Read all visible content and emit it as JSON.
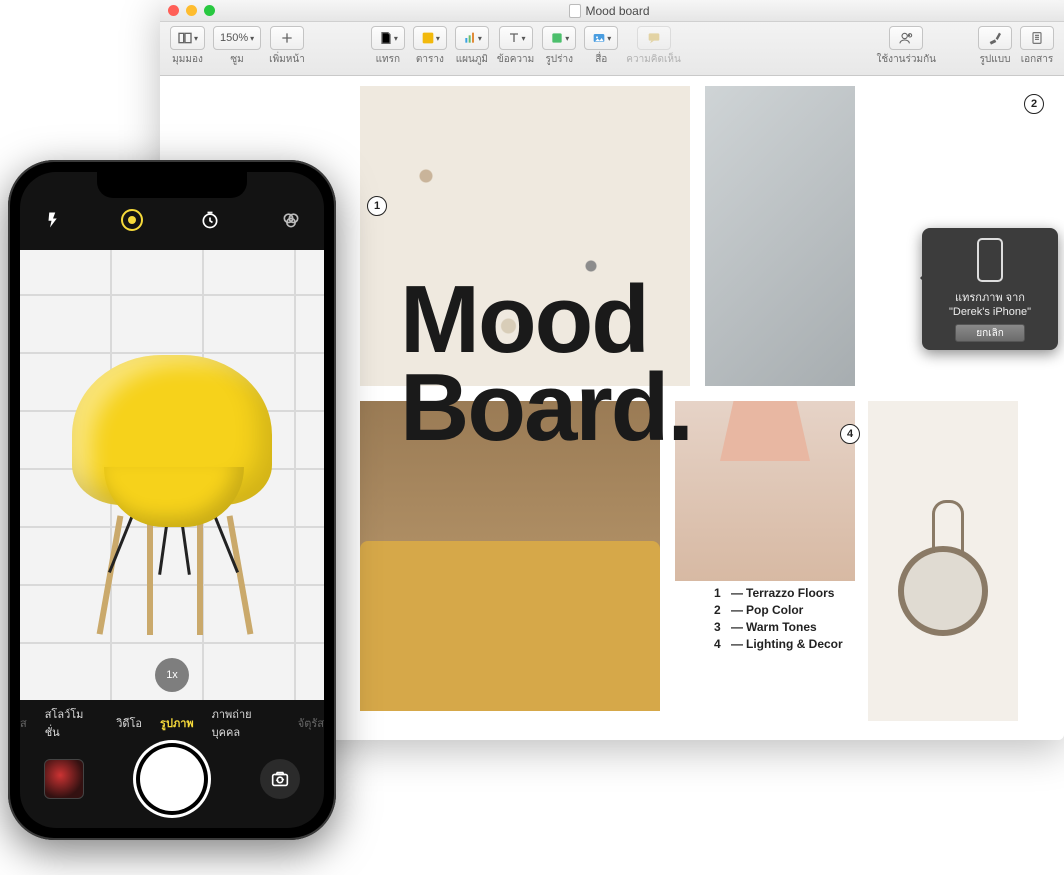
{
  "window": {
    "title": "Mood board",
    "zoom_value": "150%"
  },
  "toolbar": {
    "view": "มุมมอง",
    "zoom": "ซูม",
    "add_page": "เพิ่มหน้า",
    "insert": "แทรก",
    "table": "ตาราง",
    "chart": "แผนภูมิ",
    "text": "ข้อความ",
    "shape": "รูปร่าง",
    "media": "สื่อ",
    "comment": "ความคิดเห็น",
    "collab": "ใช้งานร่วมกัน",
    "format": "รูปแบบ",
    "document": "เอกสาร"
  },
  "page": {
    "mood_line1": "Mood",
    "mood_line2": "Board.",
    "badges": {
      "b1": "1",
      "b2": "2",
      "b4": "4"
    },
    "legend": [
      {
        "n": "1",
        "t": "Terrazzo Floors"
      },
      {
        "n": "2",
        "t": "Pop Color"
      },
      {
        "n": "3",
        "t": "Warm Tones"
      },
      {
        "n": "4",
        "t": "Lighting & Decor"
      }
    ]
  },
  "popup": {
    "line1": "แทรกภาพ จาก",
    "line2": "\"Derek's iPhone\"",
    "cancel": "ยกเลิก"
  },
  "iphone": {
    "zoom": "1x",
    "modes": {
      "timelapse_partial": "ส",
      "slomo": "สโลว์โมชั่น",
      "video": "วิดีโอ",
      "photo": "รูปภาพ",
      "portrait": "ภาพถ่ายบุคคล",
      "square_partial": "จัตุรัส"
    }
  }
}
